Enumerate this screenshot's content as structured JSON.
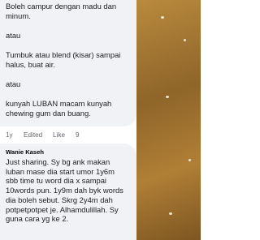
{
  "comment_top": {
    "lines": [
      "Boleh campur dengan madu dan",
      "minum.",
      "",
      "atau",
      "",
      "Tumbuk atau blend (kisar) sampai",
      "halus, buat air.",
      "",
      "atau",
      "",
      "kunyah LUBAN macam kunyah",
      "chewing gum dan buang."
    ]
  },
  "actions": {
    "time": "1y",
    "edited": "Edited",
    "like": "Like",
    "count": "9"
  },
  "reply": {
    "author": "Wanie Kaseh",
    "lines": [
      "Just sharing. Sy bg ank makan",
      "luban mase dia start umor 1y6m",
      "sbb time tu word dia x sampai",
      "10words pun. 1y9m dah byk words",
      "dia boleh sebut. Skrg 2y4m dah",
      "potpetpotpet je. Alhamdulillah. Sy",
      "guna cara yg ke 2."
    ]
  },
  "colors": {
    "bubble": "#f0f2f5",
    "muted_text": "#65676b",
    "text": "#1c1e21"
  }
}
